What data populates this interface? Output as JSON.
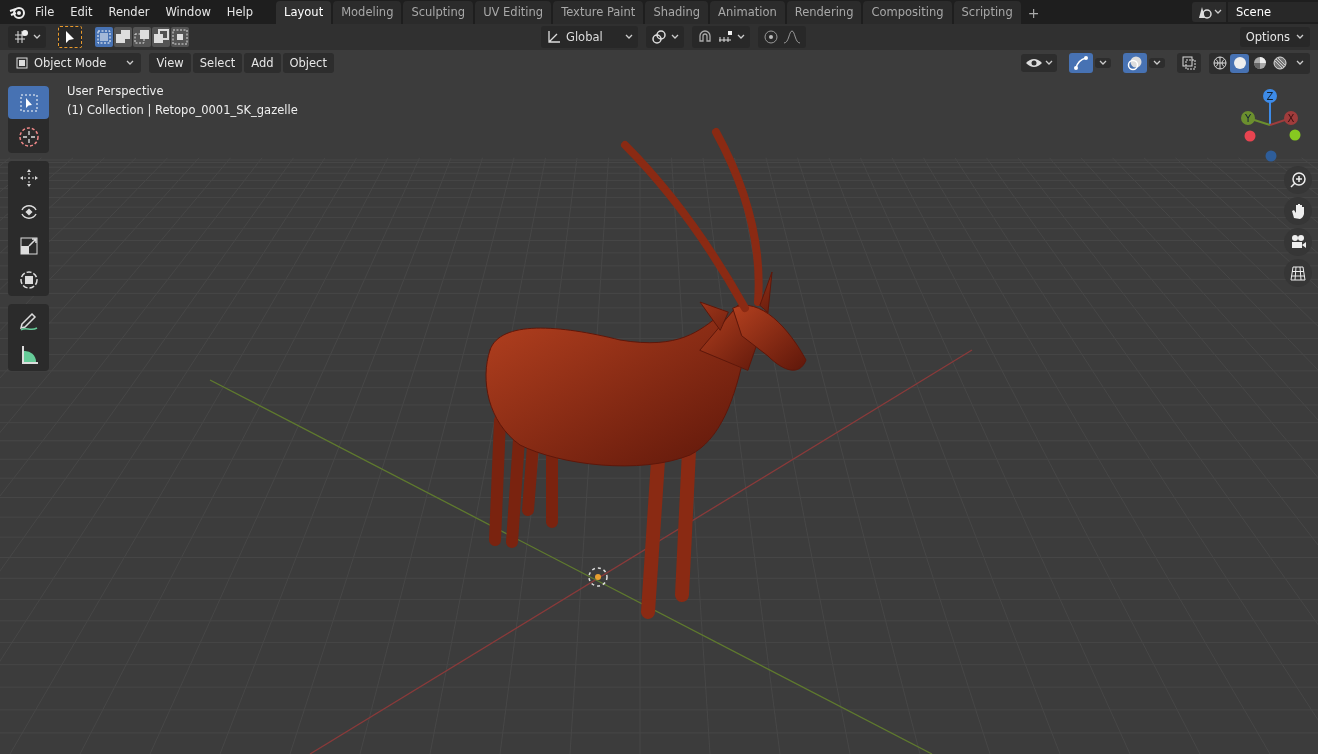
{
  "menu": [
    "File",
    "Edit",
    "Render",
    "Window",
    "Help"
  ],
  "workspaces": [
    {
      "label": "Layout",
      "selected": true
    },
    {
      "label": "Modeling",
      "selected": false
    },
    {
      "label": "Sculpting",
      "selected": false
    },
    {
      "label": "UV Editing",
      "selected": false
    },
    {
      "label": "Texture Paint",
      "selected": false
    },
    {
      "label": "Shading",
      "selected": false
    },
    {
      "label": "Animation",
      "selected": false
    },
    {
      "label": "Rendering",
      "selected": false
    },
    {
      "label": "Compositing",
      "selected": false
    },
    {
      "label": "Scripting",
      "selected": false
    }
  ],
  "add_workspace": "+",
  "scene": {
    "name": "Scene"
  },
  "tool_header": {
    "select_modes": [
      {
        "kind": "set",
        "selected": true
      },
      {
        "kind": "extend",
        "selected": false
      },
      {
        "kind": "subtract",
        "selected": false
      },
      {
        "kind": "invert",
        "selected": false
      },
      {
        "kind": "intersect",
        "selected": false
      }
    ],
    "orientation": "Global",
    "options": "Options"
  },
  "viewport_header": {
    "mode": "Object Mode",
    "menus": [
      "View",
      "Select",
      "Add",
      "Object"
    ],
    "shading": [
      {
        "kind": "wireframe",
        "selected": false
      },
      {
        "kind": "solid",
        "selected": true
      },
      {
        "kind": "material",
        "selected": false
      },
      {
        "kind": "rendered",
        "selected": false
      }
    ]
  },
  "toolbar": [
    {
      "kind": "select",
      "selected": true
    },
    {
      "kind": "cursor",
      "selected": false
    },
    {
      "kind": "move",
      "selected": false
    },
    {
      "kind": "rotate",
      "selected": false
    },
    {
      "kind": "scale",
      "selected": false
    },
    {
      "kind": "transform",
      "selected": false
    },
    {
      "kind": "annotate",
      "selected": false
    },
    {
      "kind": "measure",
      "selected": false
    }
  ],
  "overlay": {
    "view": "User Perspective",
    "object": "(1) Collection | Retopo_0001_SK_gazelle"
  },
  "gizmo": {
    "z": "Z",
    "y": "Y",
    "x": "X"
  }
}
